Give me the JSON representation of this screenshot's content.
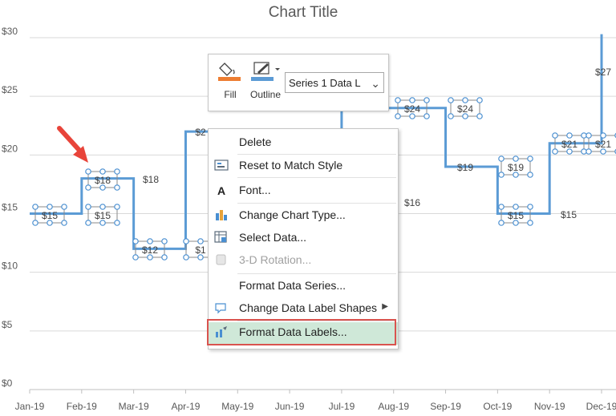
{
  "chart_data": {
    "type": "line",
    "title": "Chart Title",
    "categories": [
      "Jan-19",
      "Feb-19",
      "Mar-19",
      "Apr-19",
      "May-19",
      "Jun-19",
      "Jul-19",
      "Aug-19",
      "Sep-19",
      "Oct-19",
      "Nov-19",
      "Dec-19"
    ],
    "y_ticks": [
      "$0",
      "$5",
      "$10",
      "$15",
      "$20",
      "$25",
      "$30"
    ],
    "ylim": [
      0,
      30
    ],
    "grid": true,
    "line_color": "#5b9bd5",
    "step_values": [
      15,
      18,
      12,
      22,
      22,
      22,
      24,
      24,
      19,
      15,
      21,
      27
    ],
    "data_labels_selected": [
      {
        "cat": 0,
        "text": "$15"
      },
      {
        "cat": 1,
        "text": "$18"
      },
      {
        "cat": 1,
        "text": "$15"
      },
      {
        "cat": 2,
        "text": "$12"
      },
      {
        "cat": 3,
        "text": "$1"
      },
      {
        "cat": 7,
        "text": "$24"
      },
      {
        "cat": 8,
        "text": "$24"
      },
      {
        "cat": 9,
        "text": "$19"
      },
      {
        "cat": 9,
        "text": "$15"
      },
      {
        "cat": 10,
        "text": "$21"
      },
      {
        "cat": 11,
        "text": "$21"
      }
    ],
    "data_labels_plain": [
      {
        "text": "$18"
      },
      {
        "text": "$2"
      },
      {
        "text": "$16"
      },
      {
        "text": "$19"
      },
      {
        "text": "$15"
      },
      {
        "text": "$27"
      }
    ]
  },
  "mini_toolbar": {
    "fill_label": "Fill",
    "outline_label": "Outline",
    "fill_color": "#ed7d31",
    "outline_color": "#5b9bd5",
    "selector_value": "Series 1 Data L"
  },
  "context_menu": {
    "items": [
      {
        "label": "Delete",
        "icon": "none"
      },
      {
        "label": "Reset to Match Style",
        "icon": "reset-style-icon"
      },
      {
        "label": "Font...",
        "icon": "font-icon"
      },
      {
        "label": "Change Chart Type...",
        "icon": "chart-type-icon"
      },
      {
        "label": "Select Data...",
        "icon": "select-data-icon"
      },
      {
        "label": "3-D Rotation...",
        "icon": "rotation-3d-icon",
        "disabled": true
      },
      {
        "label": "Format Data Series...",
        "icon": "none"
      },
      {
        "label": "Change Data Label Shapes",
        "icon": "label-shapes-icon",
        "submenu": true
      },
      {
        "label": "Format Data Labels...",
        "icon": "format-labels-icon",
        "highlighted": true
      }
    ]
  },
  "annotation": {
    "arrow_color": "#e8443a",
    "highlight_color": "#d9534f"
  }
}
